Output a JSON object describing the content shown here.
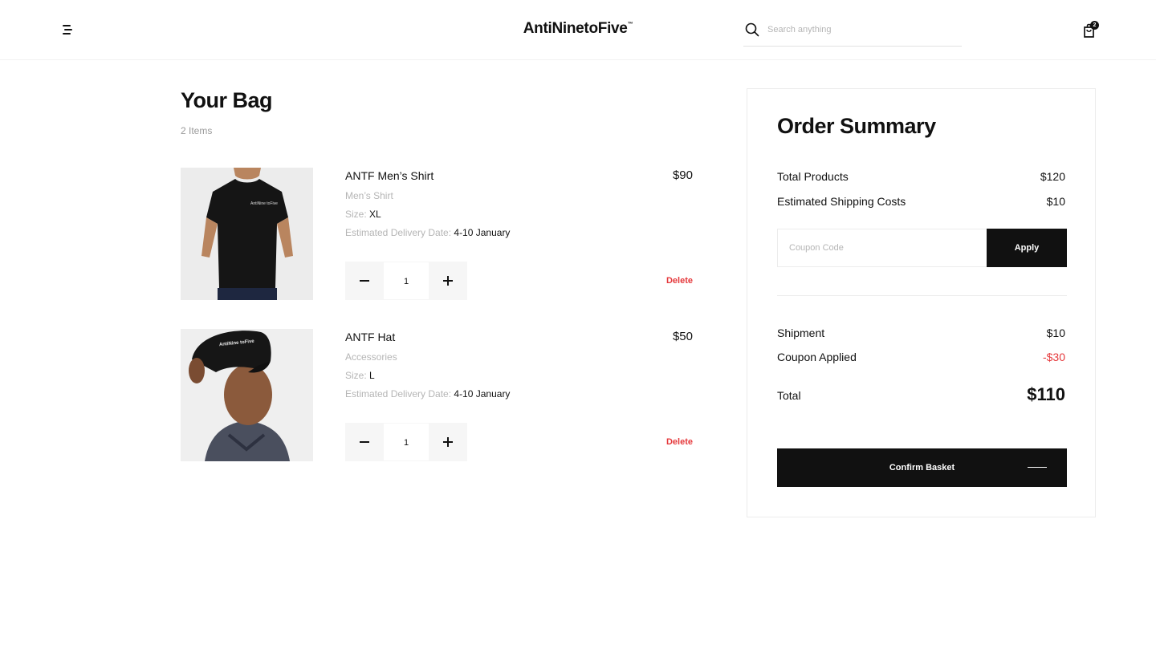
{
  "header": {
    "logo": "AntiNinetoFive",
    "logo_mark": "™",
    "search_placeholder": "Search anything",
    "cart_count": "2",
    "icons": {
      "menu": "menu-icon",
      "search": "search-icon",
      "cart": "shopping-bag-icon"
    }
  },
  "bag": {
    "title": "Your Bag",
    "count": "2 Items",
    "size_label": "Size:",
    "delivery_label": "Estimated Delivery Date:",
    "delete_label": "Delete",
    "items": [
      {
        "name": "ANTF Men’s Shirt",
        "price": "$90",
        "category": "Men’s Shirt",
        "size": "XL",
        "delivery": "4-10 January",
        "quantity": "1",
        "image": "black-t-shirt-photo",
        "print": "AntiNine toFive"
      },
      {
        "name": "ANTF Hat",
        "price": "$50",
        "category": "Accessories",
        "size": "L",
        "delivery": "4-10 January",
        "quantity": "1",
        "image": "black-cap-photo",
        "print": "AntiNine toFive"
      }
    ]
  },
  "summary": {
    "title": "Order Summary",
    "total_products_label": "Total Products",
    "total_products_value": "$120",
    "shipping_costs_label": "Estimated Shipping Costs",
    "shipping_costs_value": "$10",
    "coupon_placeholder": "Coupon Code",
    "apply_label": "Apply",
    "shipment_label": "Shipment",
    "shipment_value": "$10",
    "coupon_applied_label": "Coupon Applied",
    "coupon_applied_value": "-$30",
    "total_label": "Total",
    "total_value": "$110",
    "confirm_label": "Confirm Basket"
  },
  "colors": {
    "accent": "#111111",
    "danger": "#e5383b",
    "muted": "#b5b5b5"
  }
}
